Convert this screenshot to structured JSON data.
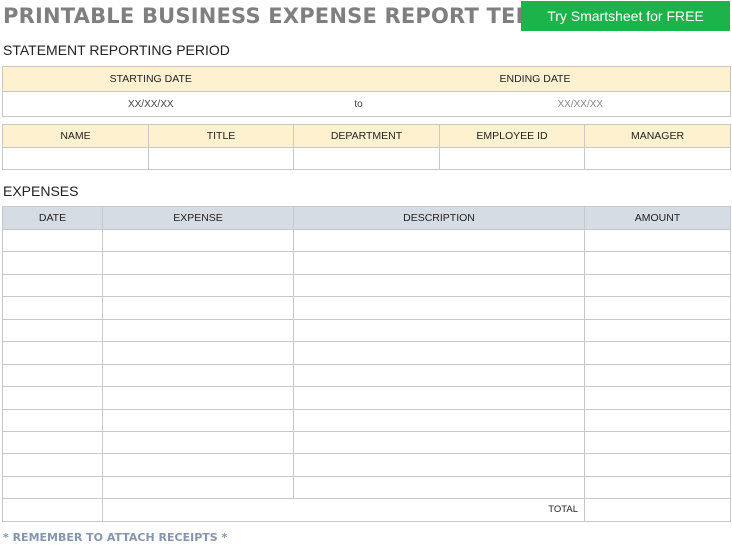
{
  "header": {
    "title": "PRINTABLE BUSINESS EXPENSE REPORT TEMPLATE",
    "cta_label": "Try Smartsheet for FREE"
  },
  "colors": {
    "cta": "#1db34b",
    "title": "#7f7f7f",
    "period_header": "#fdf1cf",
    "expense_header": "#d6dce4",
    "footnote": "#8496b0"
  },
  "period": {
    "section_label": "STATEMENT REPORTING PERIOD",
    "start_label": "STARTING DATE",
    "end_label": "ENDING DATE",
    "start_value": "XX/XX/XX",
    "separator": "to",
    "end_value": "XX/XX/XX"
  },
  "employee": {
    "columns": [
      "NAME",
      "TITLE",
      "DEPARTMENT",
      "EMPLOYEE ID",
      "MANAGER"
    ],
    "values": [
      "",
      "",
      "",
      "",
      ""
    ]
  },
  "expenses": {
    "section_label": "EXPENSES",
    "columns": [
      "DATE",
      "EXPENSE",
      "DESCRIPTION",
      "AMOUNT"
    ],
    "rows": [
      [
        "",
        "",
        "",
        ""
      ],
      [
        "",
        "",
        "",
        ""
      ],
      [
        "",
        "",
        "",
        ""
      ],
      [
        "",
        "",
        "",
        ""
      ],
      [
        "",
        "",
        "",
        ""
      ],
      [
        "",
        "",
        "",
        ""
      ],
      [
        "",
        "",
        "",
        ""
      ],
      [
        "",
        "",
        "",
        ""
      ],
      [
        "",
        "",
        "",
        ""
      ],
      [
        "",
        "",
        "",
        ""
      ],
      [
        "",
        "",
        "",
        ""
      ],
      [
        "",
        "",
        "",
        ""
      ]
    ],
    "total_label": "TOTAL",
    "total_value": ""
  },
  "footnote": "* REMEMBER TO ATTACH RECEIPTS *"
}
